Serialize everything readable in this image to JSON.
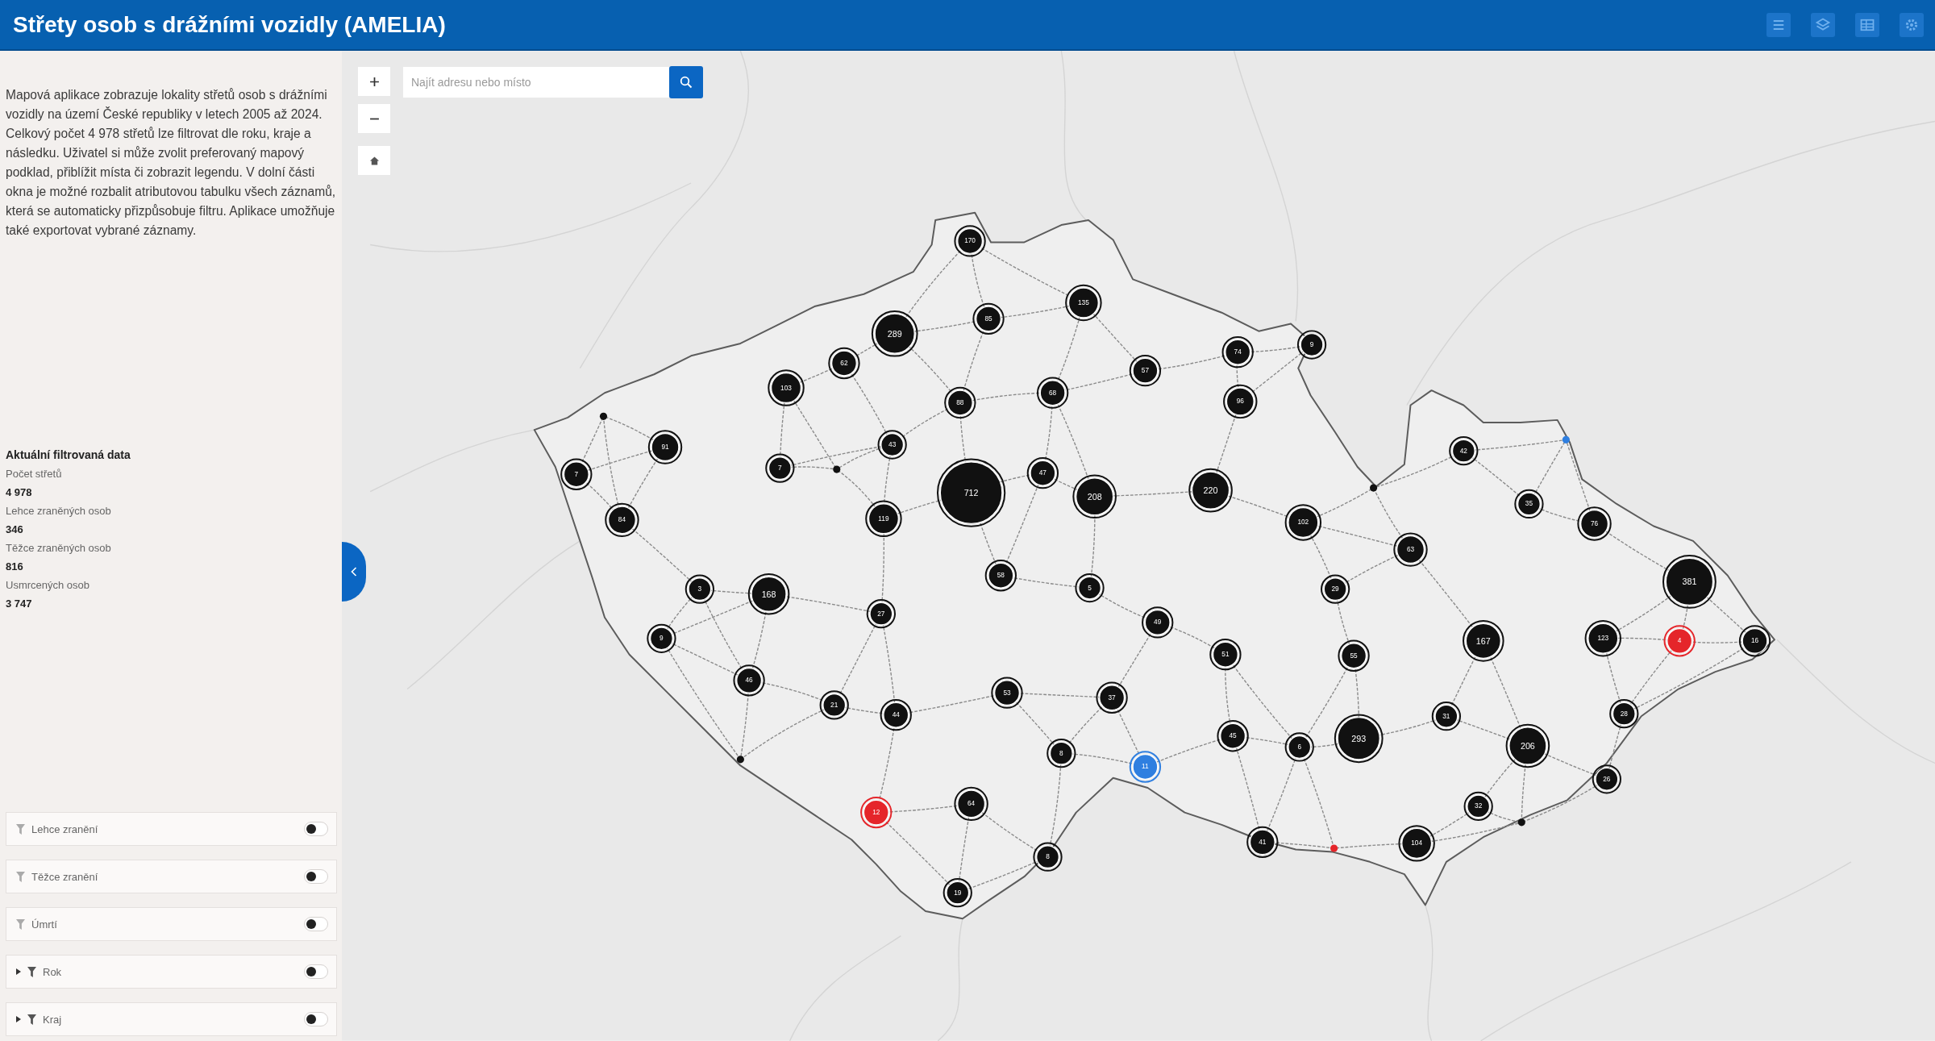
{
  "header": {
    "title": "Střety osob s drážními vozidly (AMELIA)"
  },
  "sidebar": {
    "description": "Mapová aplikace zobrazuje lokality střetů osob s drážními vozidly na území České republiky v letech 2005 až 2024. Celkový počet 4 978 střetů lze filtrovat dle roku, kraje a následku. Uživatel si může zvolit preferovaný mapový podklad, přiblížit místa či zobrazit legendu. V dolní části okna je možné rozbalit atributovou tabulku všech záznamů, která se automaticky přizpůsobuje filtru. Aplikace umožňuje také exportovat vybrané záznamy.",
    "stats": {
      "title": "Aktuální filtrovaná data",
      "items": [
        {
          "label": "Počet střetů",
          "value": "4 978"
        },
        {
          "label": "Lehce zraněných osob",
          "value": "346"
        },
        {
          "label": "Těžce zraněných osob",
          "value": "816"
        },
        {
          "label": "Usmrcených osob",
          "value": "3 747"
        }
      ]
    },
    "filters": [
      {
        "label": "Lehce zranění",
        "kind": "simple",
        "on": false
      },
      {
        "label": "Těžce zranění",
        "kind": "simple",
        "on": false
      },
      {
        "label": "Úmrtí",
        "kind": "simple",
        "on": false
      },
      {
        "label": "Rok",
        "kind": "group",
        "on": false
      },
      {
        "label": "Kraj",
        "kind": "group",
        "on": false
      }
    ]
  },
  "map": {
    "search": {
      "placeholder": "Najít adresu nebo místo"
    },
    "clusters": [
      {
        "label": "170",
        "color": "#111111"
      },
      {
        "label": "135",
        "color": "#111111"
      },
      {
        "label": "289",
        "color": "#111111"
      },
      {
        "label": "85",
        "color": "#111111"
      },
      {
        "label": "74",
        "color": "#111111"
      },
      {
        "label": "9",
        "color": "#111111"
      },
      {
        "label": "62",
        "color": "#111111"
      },
      {
        "label": "57",
        "color": "#111111"
      },
      {
        "label": "103",
        "color": "#111111"
      },
      {
        "label": "88",
        "color": "#111111"
      },
      {
        "label": "68",
        "color": "#111111"
      },
      {
        "label": "96",
        "color": "#111111"
      },
      {
        "label": "91",
        "color": "#111111"
      },
      {
        "label": "43",
        "color": "#111111"
      },
      {
        "label": "42",
        "color": "#111111"
      },
      {
        "label": "7",
        "color": "#111111"
      },
      {
        "label": "7",
        "color": "#111111"
      },
      {
        "label": "47",
        "color": "#111111"
      },
      {
        "label": "712",
        "color": "#111111"
      },
      {
        "label": "208",
        "color": "#111111"
      },
      {
        "label": "220",
        "color": "#111111"
      },
      {
        "label": "35",
        "color": "#111111"
      },
      {
        "label": "84",
        "color": "#111111"
      },
      {
        "label": "119",
        "color": "#111111"
      },
      {
        "label": "102",
        "color": "#111111"
      },
      {
        "label": "76",
        "color": "#111111"
      },
      {
        "label": "63",
        "color": "#111111"
      },
      {
        "label": "3",
        "color": "#111111"
      },
      {
        "label": "168",
        "color": "#111111"
      },
      {
        "label": "58",
        "color": "#111111"
      },
      {
        "label": "5",
        "color": "#111111"
      },
      {
        "label": "29",
        "color": "#111111"
      },
      {
        "label": "381",
        "color": "#111111"
      },
      {
        "label": "27",
        "color": "#111111"
      },
      {
        "label": "49",
        "color": "#111111"
      },
      {
        "label": "9",
        "color": "#111111"
      },
      {
        "label": "51",
        "color": "#111111"
      },
      {
        "label": "55",
        "color": "#111111"
      },
      {
        "label": "167",
        "color": "#111111"
      },
      {
        "label": "123",
        "color": "#111111"
      },
      {
        "label": "4",
        "color": "#e5252a"
      },
      {
        "label": "16",
        "color": "#111111"
      },
      {
        "label": "46",
        "color": "#111111"
      },
      {
        "label": "53",
        "color": "#111111"
      },
      {
        "label": "37",
        "color": "#111111"
      },
      {
        "label": "21",
        "color": "#111111"
      },
      {
        "label": "44",
        "color": "#111111"
      },
      {
        "label": "31",
        "color": "#111111"
      },
      {
        "label": "28",
        "color": "#111111"
      },
      {
        "label": "8",
        "color": "#111111"
      },
      {
        "label": "45",
        "color": "#111111"
      },
      {
        "label": "6",
        "color": "#111111"
      },
      {
        "label": "293",
        "color": "#111111"
      },
      {
        "label": "206",
        "color": "#111111"
      },
      {
        "label": "11",
        "color": "#2f7fe0"
      },
      {
        "label": "26",
        "color": "#111111"
      },
      {
        "label": "12",
        "color": "#e5252a"
      },
      {
        "label": "64",
        "color": "#111111"
      },
      {
        "label": "32",
        "color": "#111111"
      },
      {
        "label": "8",
        "color": "#111111"
      },
      {
        "label": "41",
        "color": "#111111"
      },
      {
        "label": "104",
        "color": "#111111"
      },
      {
        "label": "19",
        "color": "#111111"
      }
    ],
    "points": [
      {
        "color": "#111111"
      },
      {
        "color": "#2f7fe0"
      },
      {
        "color": "#111111"
      },
      {
        "color": "#111111"
      },
      {
        "color": "#111111"
      },
      {
        "color": "#111111"
      },
      {
        "color": "#e5252a"
      }
    ]
  }
}
